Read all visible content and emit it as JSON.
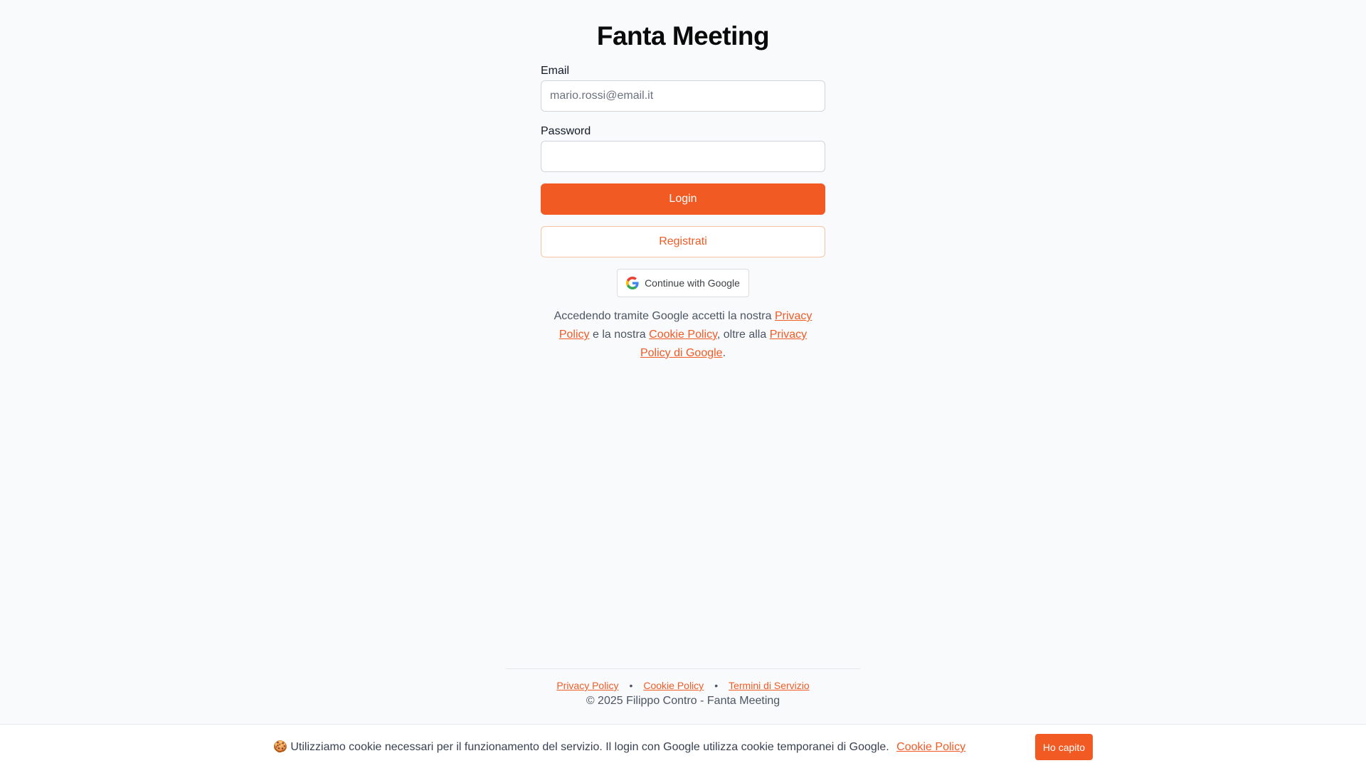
{
  "page": {
    "title": "Fanta Meeting"
  },
  "form": {
    "email_label": "Email",
    "email_placeholder": "mario.rossi@email.it",
    "email_value": "",
    "password_label": "Password",
    "password_value": "",
    "login_label": "Login",
    "register_label": "Registrati",
    "google_label": "Continue with Google",
    "google_icon": "google-g-icon"
  },
  "consent": {
    "part1": "Accedendo tramite Google accetti la nostra ",
    "privacy_link": "Privacy Policy",
    "part2": " e la nostra ",
    "cookie_link": "Cookie Policy",
    "part3": ", oltre alla ",
    "google_privacy_link": "Privacy Policy di Google",
    "part4": "."
  },
  "footer": {
    "links": [
      "Privacy Policy",
      "Cookie Policy",
      "Termini di Servizio"
    ],
    "separator": "•",
    "copyright": "© 2025 Filippo Contro - Fanta Meeting"
  },
  "cookie_banner": {
    "icon": "🍪",
    "message": "Utilizziamo cookie necessari per il funzionamento del servizio. Il login con Google utilizza cookie temporanei di Google.",
    "link": "Cookie Policy",
    "accept_label": "Ho capito"
  },
  "colors": {
    "accent": "#f25a24",
    "background": "#f9fafb"
  }
}
